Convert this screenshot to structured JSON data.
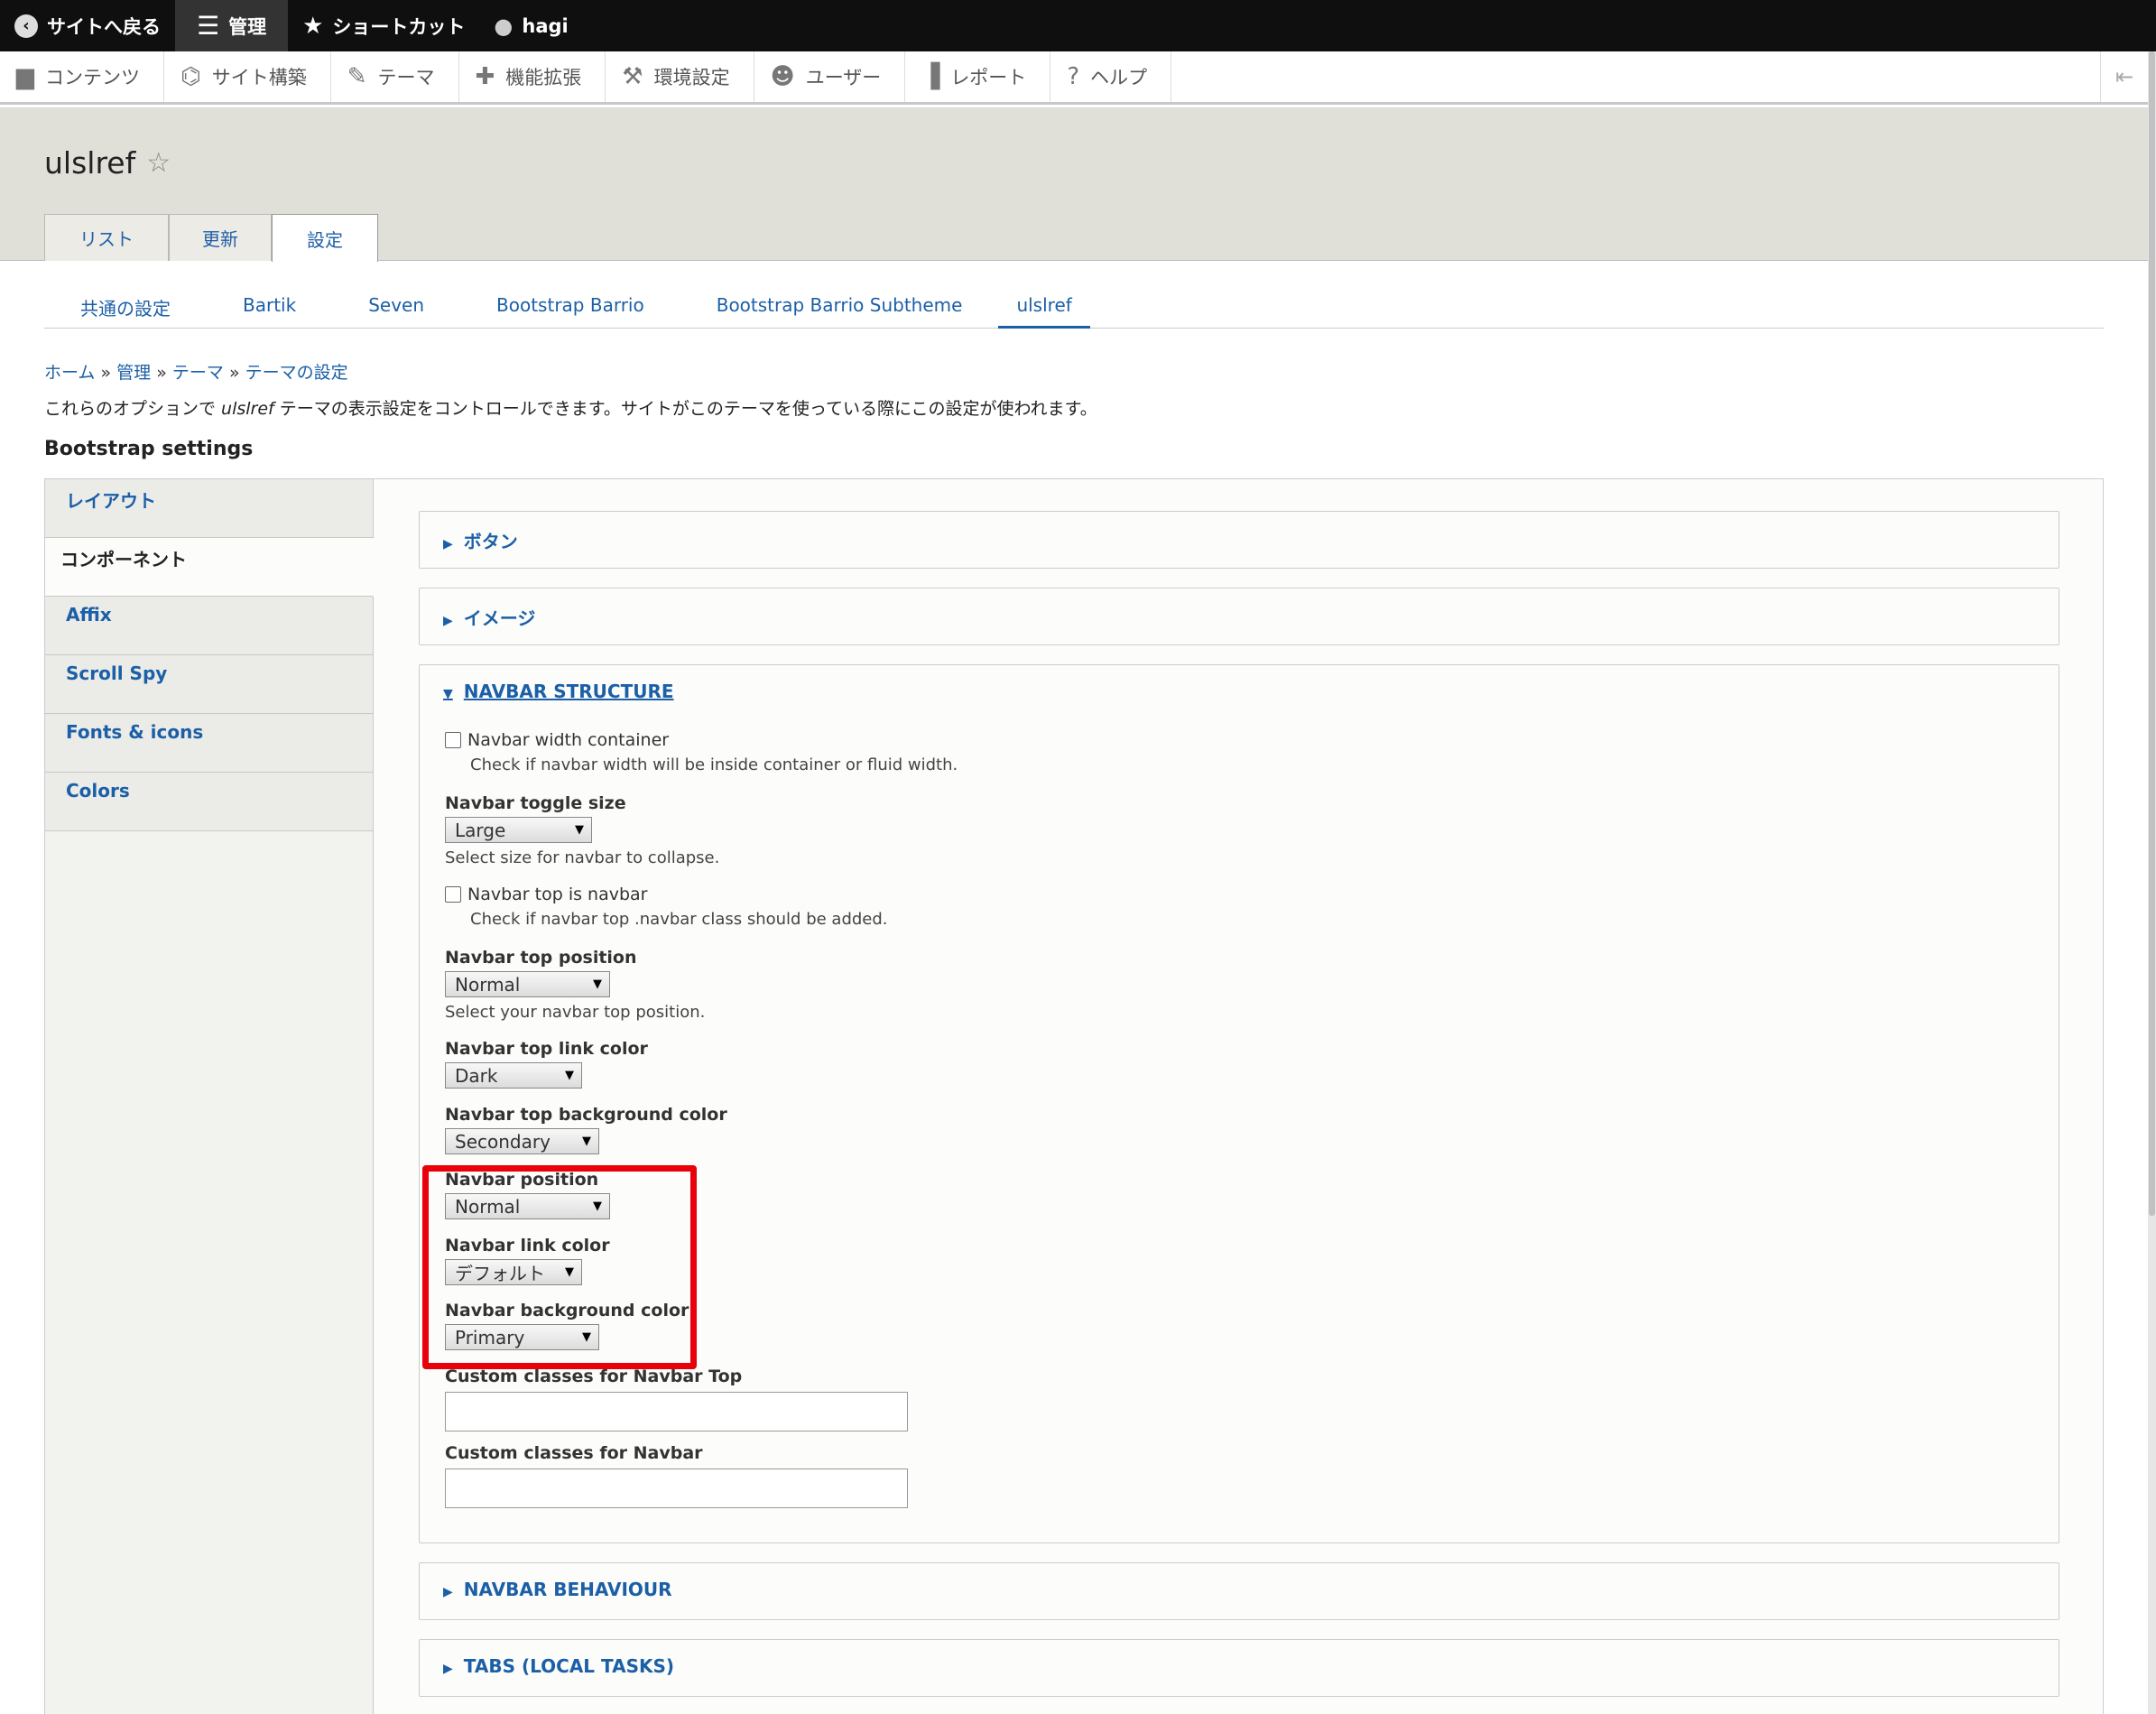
{
  "toolbar": {
    "back": "サイトへ戻る",
    "manage": "管理",
    "shortcuts": "ショートカット",
    "user": "hagi"
  },
  "menu": [
    "コンテンツ",
    "サイト構築",
    "テーマ",
    "機能拡張",
    "環境設定",
    "ユーザー",
    "レポート",
    "ヘルプ"
  ],
  "page": {
    "title": "ulslref",
    "tabs": [
      "リスト",
      "更新",
      "設定"
    ],
    "subnav": [
      "共通の設定",
      "Bartik",
      "Seven",
      "Bootstrap Barrio",
      "Bootstrap Barrio Subtheme",
      "ulslref"
    ],
    "breadcrumb": [
      "ホーム",
      "管理",
      "テーマ",
      "テーマの設定"
    ],
    "desc_pre": "これらのオプションで ",
    "desc_em": "ulslref",
    "desc_post": " テーマの表示設定をコントロールできます。サイトがこのテーマを使っている際にこの設定が使われます。",
    "section": "Bootstrap settings"
  },
  "vtabs": [
    "レイアウト",
    "コンポーネント",
    "Affix",
    "Scroll Spy",
    "Fonts & icons",
    "Colors"
  ],
  "fieldsets": {
    "buttons": "ボタン",
    "images": "イメージ",
    "navbar_structure": "NAVBAR STRUCTURE",
    "navbar_behaviour": "NAVBAR BEHAVIOUR",
    "tabs": "TABS (LOCAL TASKS)"
  },
  "form": {
    "width_container": {
      "label": "Navbar width container",
      "help": "Check if navbar width will be inside container or fluid width."
    },
    "toggle_size": {
      "label": "Navbar toggle size",
      "value": "Large",
      "help": "Select size for navbar to collapse."
    },
    "top_is_navbar": {
      "label": "Navbar top is navbar",
      "help": "Check if navbar top .navbar class should be added."
    },
    "top_position": {
      "label": "Navbar top position",
      "value": "Normal",
      "help": "Select your navbar top position."
    },
    "top_link_color": {
      "label": "Navbar top link color",
      "value": "Dark"
    },
    "top_bg_color": {
      "label": "Navbar top background color",
      "value": "Secondary"
    },
    "position": {
      "label": "Navbar position",
      "value": "Normal"
    },
    "link_color": {
      "label": "Navbar link color",
      "value": "デフォルト"
    },
    "bg_color": {
      "label": "Navbar background color",
      "value": "Primary"
    },
    "custom_top": {
      "label": "Custom classes for Navbar Top",
      "value": ""
    },
    "custom_navbar": {
      "label": "Custom classes for Navbar",
      "value": ""
    }
  },
  "colors": {
    "highlight": "#e8000b",
    "link": "#1b5fa7"
  }
}
